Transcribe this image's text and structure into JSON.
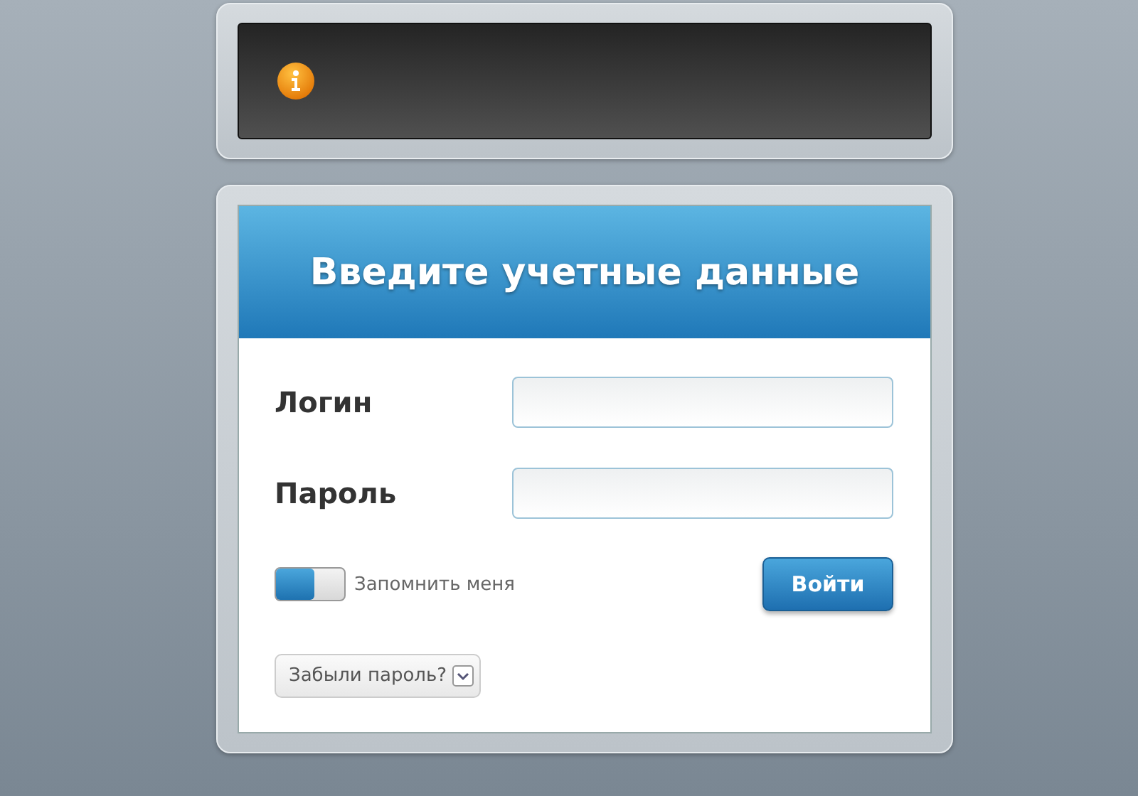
{
  "notice": {
    "kind": "info"
  },
  "login": {
    "title": "Введите учетные данные",
    "fields": [
      {
        "label": "Логин"
      },
      {
        "label": "Пароль"
      }
    ],
    "remember": {
      "label": "Запомнить меня",
      "on": false
    },
    "submit": "Войти",
    "forgot": "Забыли пароль?"
  }
}
